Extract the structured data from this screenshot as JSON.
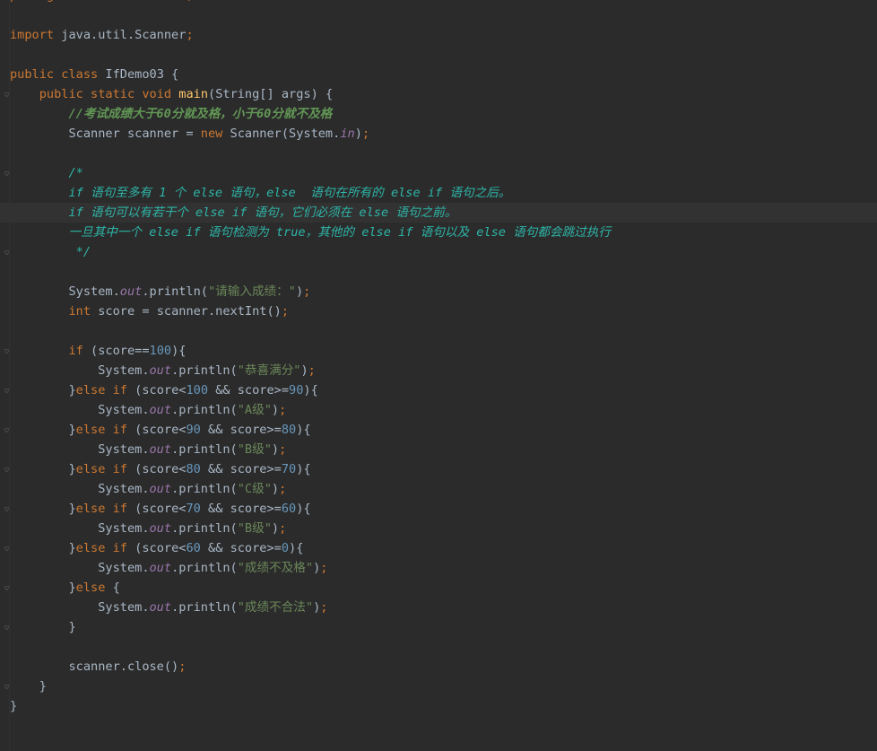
{
  "editor": {
    "file_language": "java",
    "current_line_index": 11,
    "lines": [
      {
        "tokens": [
          [
            "kw",
            "package"
          ],
          [
            "plain",
            " com.buhui.struct"
          ],
          [
            "pun",
            ";"
          ]
        ]
      },
      {
        "tokens": []
      },
      {
        "tokens": [
          [
            "kw",
            "import"
          ],
          [
            "plain",
            " java.util.Scanner"
          ],
          [
            "pun",
            ";"
          ]
        ]
      },
      {
        "tokens": []
      },
      {
        "tokens": [
          [
            "kw",
            "public class"
          ],
          [
            "plain",
            " IfDemo03 {"
          ]
        ]
      },
      {
        "tokens": [
          [
            "plain",
            "    "
          ],
          [
            "kw",
            "public static void"
          ],
          [
            "plain",
            " "
          ],
          [
            "fn",
            "main"
          ],
          [
            "plain",
            "(String[] args) {"
          ]
        ],
        "fold": true
      },
      {
        "tokens": [
          [
            "plain",
            "        "
          ],
          [
            "cmt",
            "//考试成绩大于60分就及格，小于60分就不及格"
          ]
        ]
      },
      {
        "tokens": [
          [
            "plain",
            "        Scanner scanner = "
          ],
          [
            "kw",
            "new"
          ],
          [
            "plain",
            " Scanner(System."
          ],
          [
            "fld",
            "in"
          ],
          [
            "plain",
            ")"
          ],
          [
            "pun",
            ";"
          ]
        ]
      },
      {
        "tokens": []
      },
      {
        "tokens": [
          [
            "plain",
            "        "
          ],
          [
            "cmt2",
            "/*"
          ]
        ],
        "fold": true
      },
      {
        "tokens": [
          [
            "plain",
            "        "
          ],
          [
            "cmt2b",
            "if"
          ],
          [
            "cmt2",
            " 语句至多有 1 个 "
          ],
          [
            "cmt2b",
            "else"
          ],
          [
            "cmt2",
            " 语句，"
          ],
          [
            "cmt2b",
            "else"
          ],
          [
            "cmt2",
            "  语句在所有的 "
          ],
          [
            "cmt2b",
            "else if"
          ],
          [
            "cmt2",
            " 语句之后。"
          ]
        ]
      },
      {
        "tokens": [
          [
            "plain",
            "        "
          ],
          [
            "cmt2b",
            "if"
          ],
          [
            "cmt2",
            " 语句可以有若干个 "
          ],
          [
            "cmt2b",
            "else if"
          ],
          [
            "cmt2",
            " 语句，它们必须在 "
          ],
          [
            "cmt2b",
            "else"
          ],
          [
            "cmt2",
            " 语句之前。"
          ]
        ]
      },
      {
        "tokens": [
          [
            "plain",
            "        "
          ],
          [
            "cmt2",
            "一旦其中一个 "
          ],
          [
            "cmt2b",
            "else if"
          ],
          [
            "cmt2",
            " 语句检测为 "
          ],
          [
            "cmt2b",
            "true"
          ],
          [
            "cmt2",
            "，其他的 "
          ],
          [
            "cmt2b",
            "else if"
          ],
          [
            "cmt2",
            " 语句以及 "
          ],
          [
            "cmt2b",
            "else"
          ],
          [
            "cmt2",
            " 语句都会跳过执行"
          ]
        ]
      },
      {
        "tokens": [
          [
            "plain",
            "         "
          ],
          [
            "cmt2",
            "*/"
          ]
        ],
        "fold": true
      },
      {
        "tokens": []
      },
      {
        "tokens": [
          [
            "plain",
            "        System."
          ],
          [
            "fld",
            "out"
          ],
          [
            "plain",
            ".println("
          ],
          [
            "str",
            "\"请输入成绩：\""
          ],
          [
            "plain",
            ")"
          ],
          [
            "pun",
            ";"
          ]
        ]
      },
      {
        "tokens": [
          [
            "plain",
            "        "
          ],
          [
            "kw",
            "int"
          ],
          [
            "plain",
            " score = scanner.nextInt()"
          ],
          [
            "pun",
            ";"
          ]
        ]
      },
      {
        "tokens": []
      },
      {
        "tokens": [
          [
            "plain",
            "        "
          ],
          [
            "kw",
            "if"
          ],
          [
            "plain",
            " (score=="
          ],
          [
            "num",
            "100"
          ],
          [
            "plain",
            "){"
          ]
        ],
        "fold": true
      },
      {
        "tokens": [
          [
            "plain",
            "            System."
          ],
          [
            "fld",
            "out"
          ],
          [
            "plain",
            ".println("
          ],
          [
            "str",
            "\"恭喜满分\""
          ],
          [
            "plain",
            ")"
          ],
          [
            "pun",
            ";"
          ]
        ]
      },
      {
        "tokens": [
          [
            "plain",
            "        }"
          ],
          [
            "kw",
            "else if"
          ],
          [
            "plain",
            " (score<"
          ],
          [
            "num",
            "100"
          ],
          [
            "plain",
            " && score>="
          ],
          [
            "num",
            "90"
          ],
          [
            "plain",
            "){"
          ]
        ],
        "fold": true
      },
      {
        "tokens": [
          [
            "plain",
            "            System."
          ],
          [
            "fld",
            "out"
          ],
          [
            "plain",
            ".println("
          ],
          [
            "str",
            "\"A级\""
          ],
          [
            "plain",
            ")"
          ],
          [
            "pun",
            ";"
          ]
        ]
      },
      {
        "tokens": [
          [
            "plain",
            "        }"
          ],
          [
            "kw",
            "else if"
          ],
          [
            "plain",
            " (score<"
          ],
          [
            "num",
            "90"
          ],
          [
            "plain",
            " && score>="
          ],
          [
            "num",
            "80"
          ],
          [
            "plain",
            "){"
          ]
        ],
        "fold": true
      },
      {
        "tokens": [
          [
            "plain",
            "            System."
          ],
          [
            "fld",
            "out"
          ],
          [
            "plain",
            ".println("
          ],
          [
            "str",
            "\"B级\""
          ],
          [
            "plain",
            ")"
          ],
          [
            "pun",
            ";"
          ]
        ]
      },
      {
        "tokens": [
          [
            "plain",
            "        }"
          ],
          [
            "kw",
            "else if"
          ],
          [
            "plain",
            " (score<"
          ],
          [
            "num",
            "80"
          ],
          [
            "plain",
            " && score>="
          ],
          [
            "num",
            "70"
          ],
          [
            "plain",
            "){"
          ]
        ],
        "fold": true
      },
      {
        "tokens": [
          [
            "plain",
            "            System."
          ],
          [
            "fld",
            "out"
          ],
          [
            "plain",
            ".println("
          ],
          [
            "str",
            "\"C级\""
          ],
          [
            "plain",
            ")"
          ],
          [
            "pun",
            ";"
          ]
        ]
      },
      {
        "tokens": [
          [
            "plain",
            "        }"
          ],
          [
            "kw",
            "else if"
          ],
          [
            "plain",
            " (score<"
          ],
          [
            "num",
            "70"
          ],
          [
            "plain",
            " && score>="
          ],
          [
            "num",
            "60"
          ],
          [
            "plain",
            "){"
          ]
        ],
        "fold": true
      },
      {
        "tokens": [
          [
            "plain",
            "            System."
          ],
          [
            "fld",
            "out"
          ],
          [
            "plain",
            ".println("
          ],
          [
            "str",
            "\"B级\""
          ],
          [
            "plain",
            ")"
          ],
          [
            "pun",
            ";"
          ]
        ]
      },
      {
        "tokens": [
          [
            "plain",
            "        }"
          ],
          [
            "kw",
            "else if"
          ],
          [
            "plain",
            " (score<"
          ],
          [
            "num",
            "60"
          ],
          [
            "plain",
            " && score>="
          ],
          [
            "num",
            "0"
          ],
          [
            "plain",
            "){"
          ]
        ],
        "fold": true
      },
      {
        "tokens": [
          [
            "plain",
            "            System."
          ],
          [
            "fld",
            "out"
          ],
          [
            "plain",
            ".println("
          ],
          [
            "str",
            "\"成绩不及格\""
          ],
          [
            "plain",
            ")"
          ],
          [
            "pun",
            ";"
          ]
        ]
      },
      {
        "tokens": [
          [
            "plain",
            "        }"
          ],
          [
            "kw",
            "else"
          ],
          [
            "plain",
            " {"
          ]
        ],
        "fold": true
      },
      {
        "tokens": [
          [
            "plain",
            "            System."
          ],
          [
            "fld",
            "out"
          ],
          [
            "plain",
            ".println("
          ],
          [
            "str",
            "\"成绩不合法\""
          ],
          [
            "plain",
            ")"
          ],
          [
            "pun",
            ";"
          ]
        ]
      },
      {
        "tokens": [
          [
            "plain",
            "        }"
          ]
        ],
        "fold": true
      },
      {
        "tokens": []
      },
      {
        "tokens": [
          [
            "plain",
            "        scanner.close()"
          ],
          [
            "pun",
            ";"
          ]
        ]
      },
      {
        "tokens": [
          [
            "plain",
            "    }"
          ]
        ],
        "fold": true
      },
      {
        "tokens": [
          [
            "plain",
            "}"
          ]
        ]
      }
    ]
  }
}
